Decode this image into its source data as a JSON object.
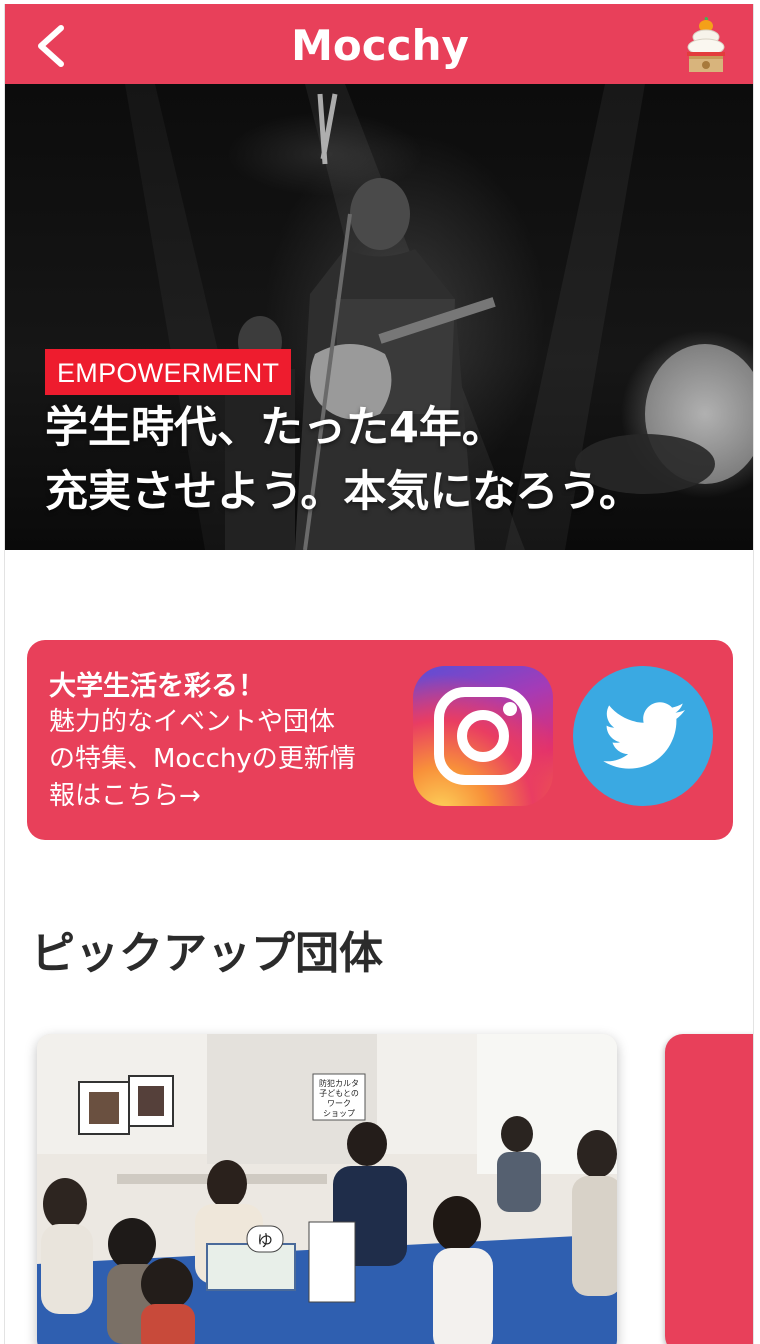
{
  "header": {
    "title": "Mocchy",
    "back_icon": "chevron-left-icon",
    "right_icon": "kagami-mochi-icon",
    "background": "#e8405a"
  },
  "hero": {
    "tag": "EMPOWERMENT",
    "tag_color": "#ee1c2e",
    "headline_line1": "学生時代、たった4年。",
    "headline_line2": "充実させよう。本気になろう。"
  },
  "sns_banner": {
    "lead": "大学生活を彩る！",
    "body_lines": [
      "魅力的なイベントや団体",
      "の特集、Mocchyの更新情",
      "報はこちら→"
    ],
    "instagram_icon": "instagram-icon",
    "twitter_icon": "twitter-icon",
    "background": "#e8405a",
    "twitter_color": "#3aa9e2"
  },
  "pickup": {
    "title": "ピックアップ団体",
    "card_sign": [
      "防犯カルタ",
      "子どもとの",
      "ワーク",
      "ショップ"
    ],
    "karuta_text": "ゆ"
  }
}
